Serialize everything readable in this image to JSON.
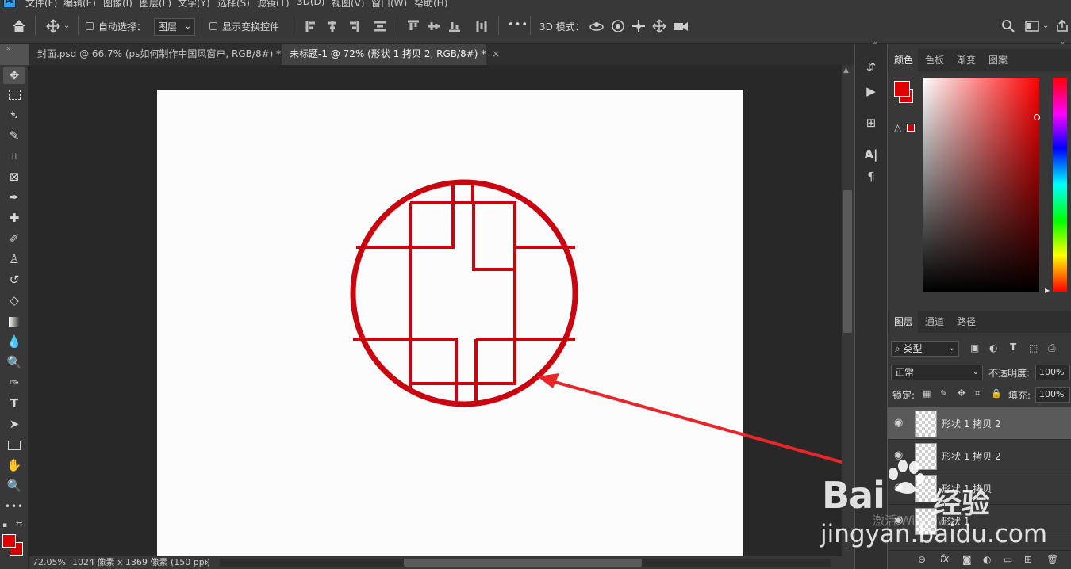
{
  "menu": {
    "app_logo": "Ps",
    "items": [
      "文件(F)",
      "编辑(E)",
      "图像(I)",
      "图层(L)",
      "文字(Y)",
      "选择(S)",
      "滤镜(T)",
      "3D(D)",
      "视图(V)",
      "窗口(W)",
      "帮助(H)"
    ]
  },
  "options": {
    "auto_select_label": "自动选择：",
    "auto_select_value": "图层",
    "show_transform_label": "显示变换控件",
    "mode_3d_label": "3D 模式：",
    "more": "•••"
  },
  "tabs": [
    {
      "title": "封面.psd @ 66.7% (ps如何制作中国风窗户, RGB/8#) *",
      "close": "×",
      "active": false
    },
    {
      "title": "未标题-1 @ 72% (形状 1 拷贝 2, RGB/8#) *",
      "close": "×",
      "active": true
    }
  ],
  "status": {
    "zoom": "72.05%",
    "doc_info": "1024 像素 x 1369 像素 (150 ppi)",
    "arrow": "›"
  },
  "color_panel": {
    "tabs": [
      "颜色",
      "色板",
      "渐变",
      "图案"
    ],
    "active_tab": "颜色",
    "foreground": "#e00000",
    "background": "#d00000",
    "warning_icon": "△"
  },
  "layers_panel": {
    "tabs": [
      "图层",
      "通道",
      "路径"
    ],
    "active_tab": "图层",
    "filter_label": "类型",
    "blend_mode": "正常",
    "opacity_label": "不透明度:",
    "opacity_value": "100%",
    "lock_label": "锁定:",
    "fill_label": "填充:",
    "fill_value": "100%",
    "layers": [
      {
        "name": "形状 1 拷贝 2",
        "selected": true
      },
      {
        "name": "形状 1 拷贝 2",
        "selected": false
      },
      {
        "name": "形状 1 拷贝",
        "selected": false
      },
      {
        "name": "形状 1",
        "selected": false
      }
    ],
    "footer_icons": [
      "link-icon",
      "fx-icon",
      "mask-icon",
      "adjustment-icon",
      "folder-icon",
      "new-layer-icon",
      "trash-icon"
    ]
  },
  "watermark": {
    "logo_text": "Bai",
    "logo_cn": "经验",
    "url": "jingyan.baidu.com",
    "activate": "激活 Windows"
  },
  "colors": {
    "accent_red": "#cc0000",
    "arrow_red": "#e8262a"
  }
}
